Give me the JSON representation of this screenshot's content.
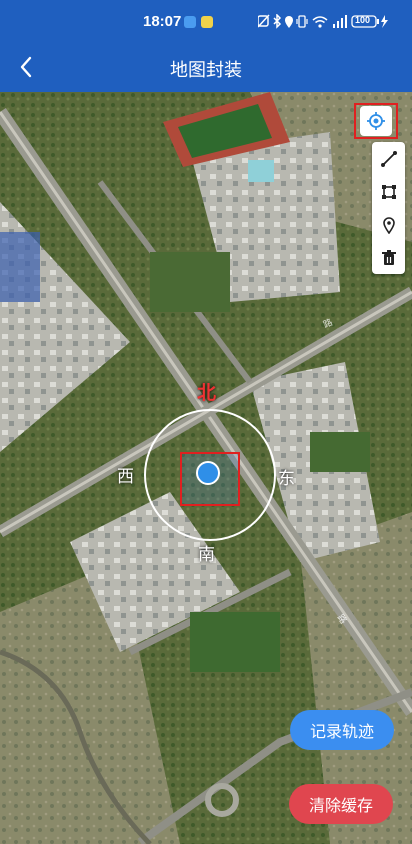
{
  "status_bar": {
    "time": "18:07",
    "icons": [
      "mute-icon",
      "bluetooth-icon",
      "location-icon",
      "vibrate-icon",
      "wifi-icon",
      "signal-icon",
      "battery-icon"
    ],
    "battery": "100"
  },
  "nav": {
    "title": "地图封装",
    "back_icon": "chevron-left-icon"
  },
  "map": {
    "compass": {
      "north": "北",
      "south": "南",
      "east": "东",
      "west": "西"
    }
  },
  "toolbar": {
    "locate_icon": "locate-icon",
    "tools": [
      "polyline-icon",
      "polygon-icon",
      "marker-icon",
      "trash-icon"
    ]
  },
  "actions": {
    "record_label": "记录轨迹",
    "clear_label": "清除缓存"
  },
  "colors": {
    "primary": "#1f5fbf",
    "record": "#3b8ef0",
    "clear": "#e0464f",
    "highlight": "#e02020",
    "location_dot": "#2f8fe8"
  }
}
